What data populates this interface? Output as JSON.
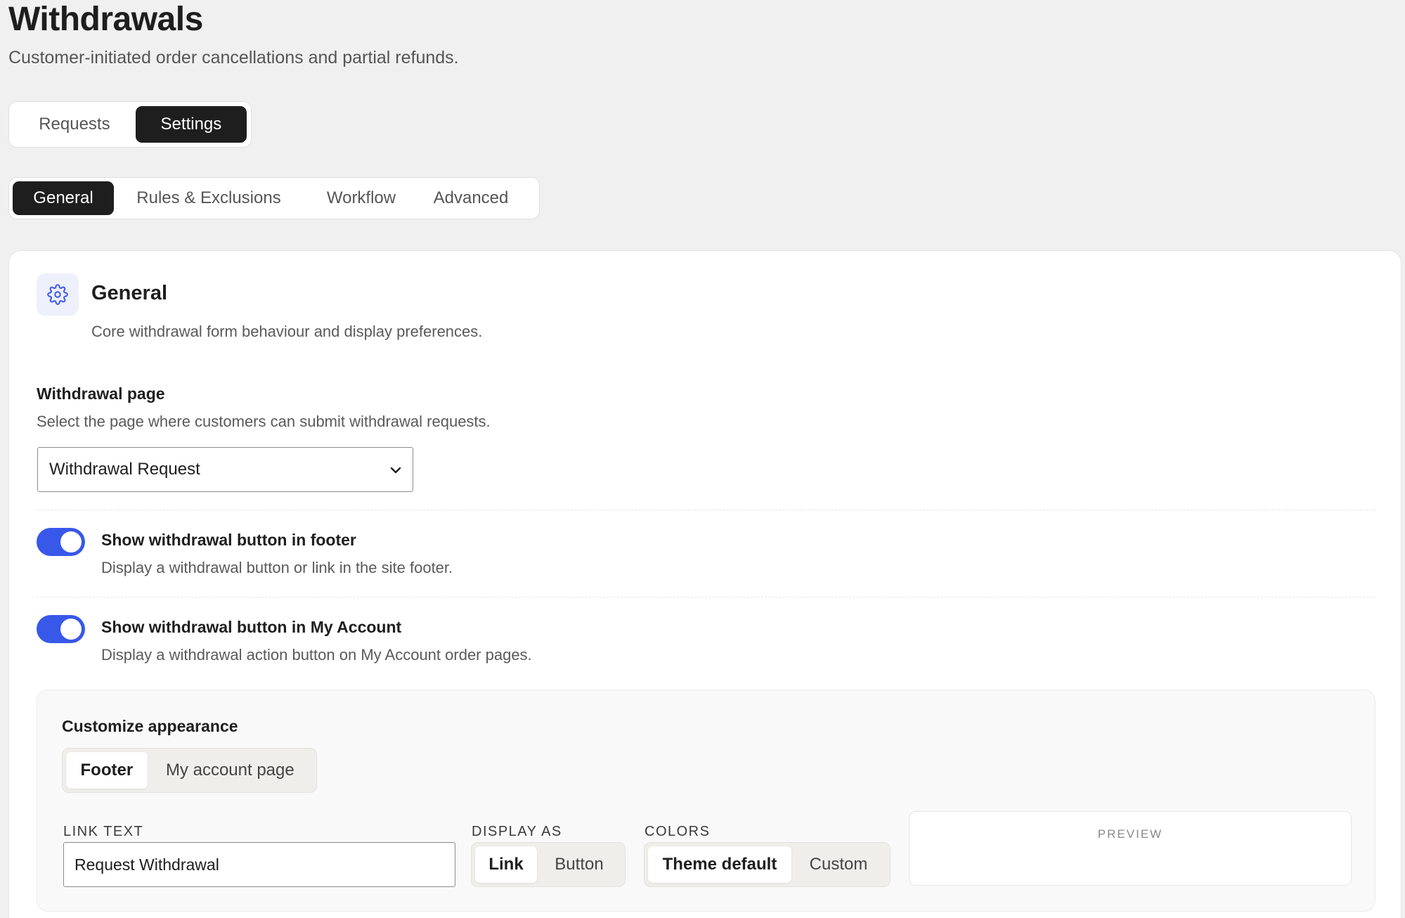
{
  "header": {
    "title": "Withdrawals",
    "subtitle": "Customer-initiated order cancellations and partial refunds."
  },
  "top_tabs": [
    {
      "label": "Requests",
      "active": false
    },
    {
      "label": "Settings",
      "active": true
    }
  ],
  "sub_tabs": [
    {
      "label": "General",
      "active": true
    },
    {
      "label": "Rules & Exclusions",
      "active": false
    },
    {
      "label": "Workflow",
      "active": false
    },
    {
      "label": "Advanced",
      "active": false
    }
  ],
  "section": {
    "icon": "gear-icon",
    "title": "General",
    "description": "Core withdrawal form behaviour and display preferences."
  },
  "withdrawal_page": {
    "label": "Withdrawal page",
    "help": "Select the page where customers can submit withdrawal requests.",
    "selected": "Withdrawal Request"
  },
  "toggles": [
    {
      "label": "Show withdrawal button in footer",
      "help": "Display a withdrawal button or link in the site footer.",
      "enabled": true
    },
    {
      "label": "Show withdrawal button in My Account",
      "help": "Display a withdrawal action button on My Account order pages.",
      "enabled": true
    }
  ],
  "appearance": {
    "title": "Customize appearance",
    "tabs": [
      {
        "label": "Footer",
        "active": true
      },
      {
        "label": "My account page",
        "active": false
      }
    ],
    "link_text_label": "LINK TEXT",
    "link_text_value": "Request Withdrawal",
    "display_as_label": "DISPLAY AS",
    "display_as_options": [
      {
        "label": "Link",
        "active": true
      },
      {
        "label": "Button",
        "active": false
      }
    ],
    "colors_label": "COLORS",
    "colors_options": [
      {
        "label": "Theme default",
        "active": true
      },
      {
        "label": "Custom",
        "active": false
      }
    ],
    "preview_label": "PREVIEW"
  },
  "colors": {
    "accent": "#3858e9",
    "dark": "#1e1e1e",
    "background": "#f0f0f0"
  }
}
